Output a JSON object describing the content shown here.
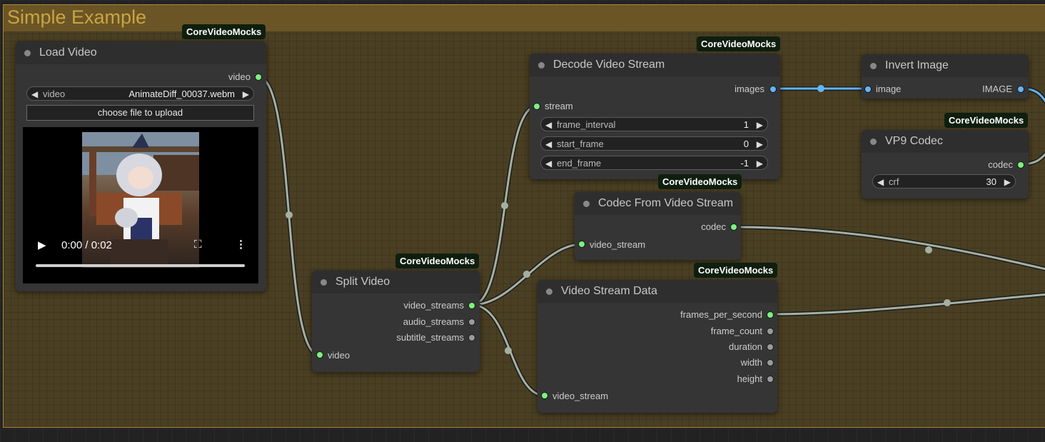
{
  "group": {
    "title": "Simple Example"
  },
  "badge_text": "CoreVideoMocks",
  "load_video": {
    "title": "Load Video",
    "output": "video",
    "widget_name": "video",
    "widget_value": "AnimateDiff_00037.webm",
    "upload_label": "choose file to upload",
    "time": "0:00 / 0:02"
  },
  "split_video": {
    "title": "Split Video",
    "outputs": [
      "video_streams",
      "audio_streams",
      "subtitle_streams"
    ],
    "input": "video"
  },
  "decode_video_stream": {
    "title": "Decode Video Stream",
    "output": "images",
    "input": "stream",
    "widgets": [
      {
        "name": "frame_interval",
        "value": "1"
      },
      {
        "name": "start_frame",
        "value": "0"
      },
      {
        "name": "end_frame",
        "value": "-1"
      }
    ]
  },
  "codec_from_video_stream": {
    "title": "Codec From Video Stream",
    "output": "codec",
    "input": "video_stream"
  },
  "video_stream_data": {
    "title": "Video Stream Data",
    "outputs": [
      "frames_per_second",
      "frame_count",
      "duration",
      "width",
      "height"
    ],
    "input": "video_stream"
  },
  "invert_image": {
    "title": "Invert Image",
    "input": "image",
    "output": "IMAGE"
  },
  "vp9_codec": {
    "title": "VP9 Codec",
    "output": "codec",
    "widget_name": "crf",
    "widget_value": "30"
  },
  "colors": {
    "link_grey": "#a5b0a2",
    "link_blue": "#64b5f6",
    "port_green": "#7cf27c",
    "group_title": "#c9a442"
  }
}
